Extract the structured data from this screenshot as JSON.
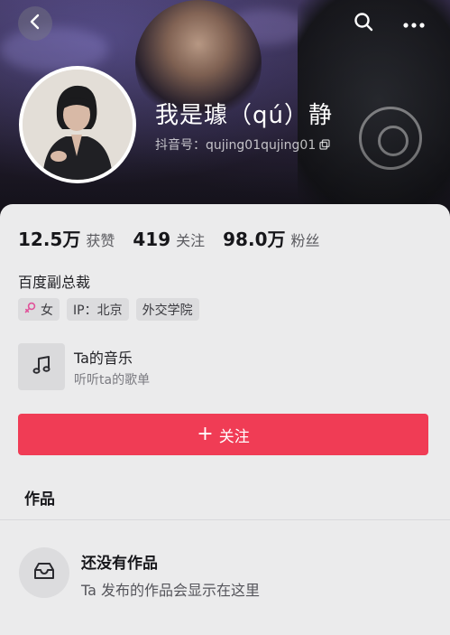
{
  "profile": {
    "nickname": "我是璩（qú）静",
    "douyin_id": "抖音号：qujing01qujing01"
  },
  "stats": [
    {
      "value": "12.5万",
      "label": "获赞"
    },
    {
      "value": "419",
      "label": "关注"
    },
    {
      "value": "98.0万",
      "label": "粉丝"
    }
  ],
  "bio": "百度副总裁",
  "tags": {
    "gender": "女",
    "ip": "IP：北京",
    "school": "外交学院"
  },
  "music": {
    "title": "Ta的音乐",
    "subtitle": "听听ta的歌单"
  },
  "actions": {
    "follow_plus": "+",
    "follow_label": "关注"
  },
  "works": {
    "title": "作品",
    "empty_title": "还没有作品",
    "empty_subtitle": "Ta 发布的作品会显示在这里"
  },
  "colors": {
    "follow_button": "#f03c55",
    "gender_icon": "#e0539a"
  },
  "icons": [
    "back-icon",
    "search-icon",
    "more-icon",
    "copy-icon",
    "female-icon",
    "music-note-icon",
    "inbox-icon"
  ]
}
